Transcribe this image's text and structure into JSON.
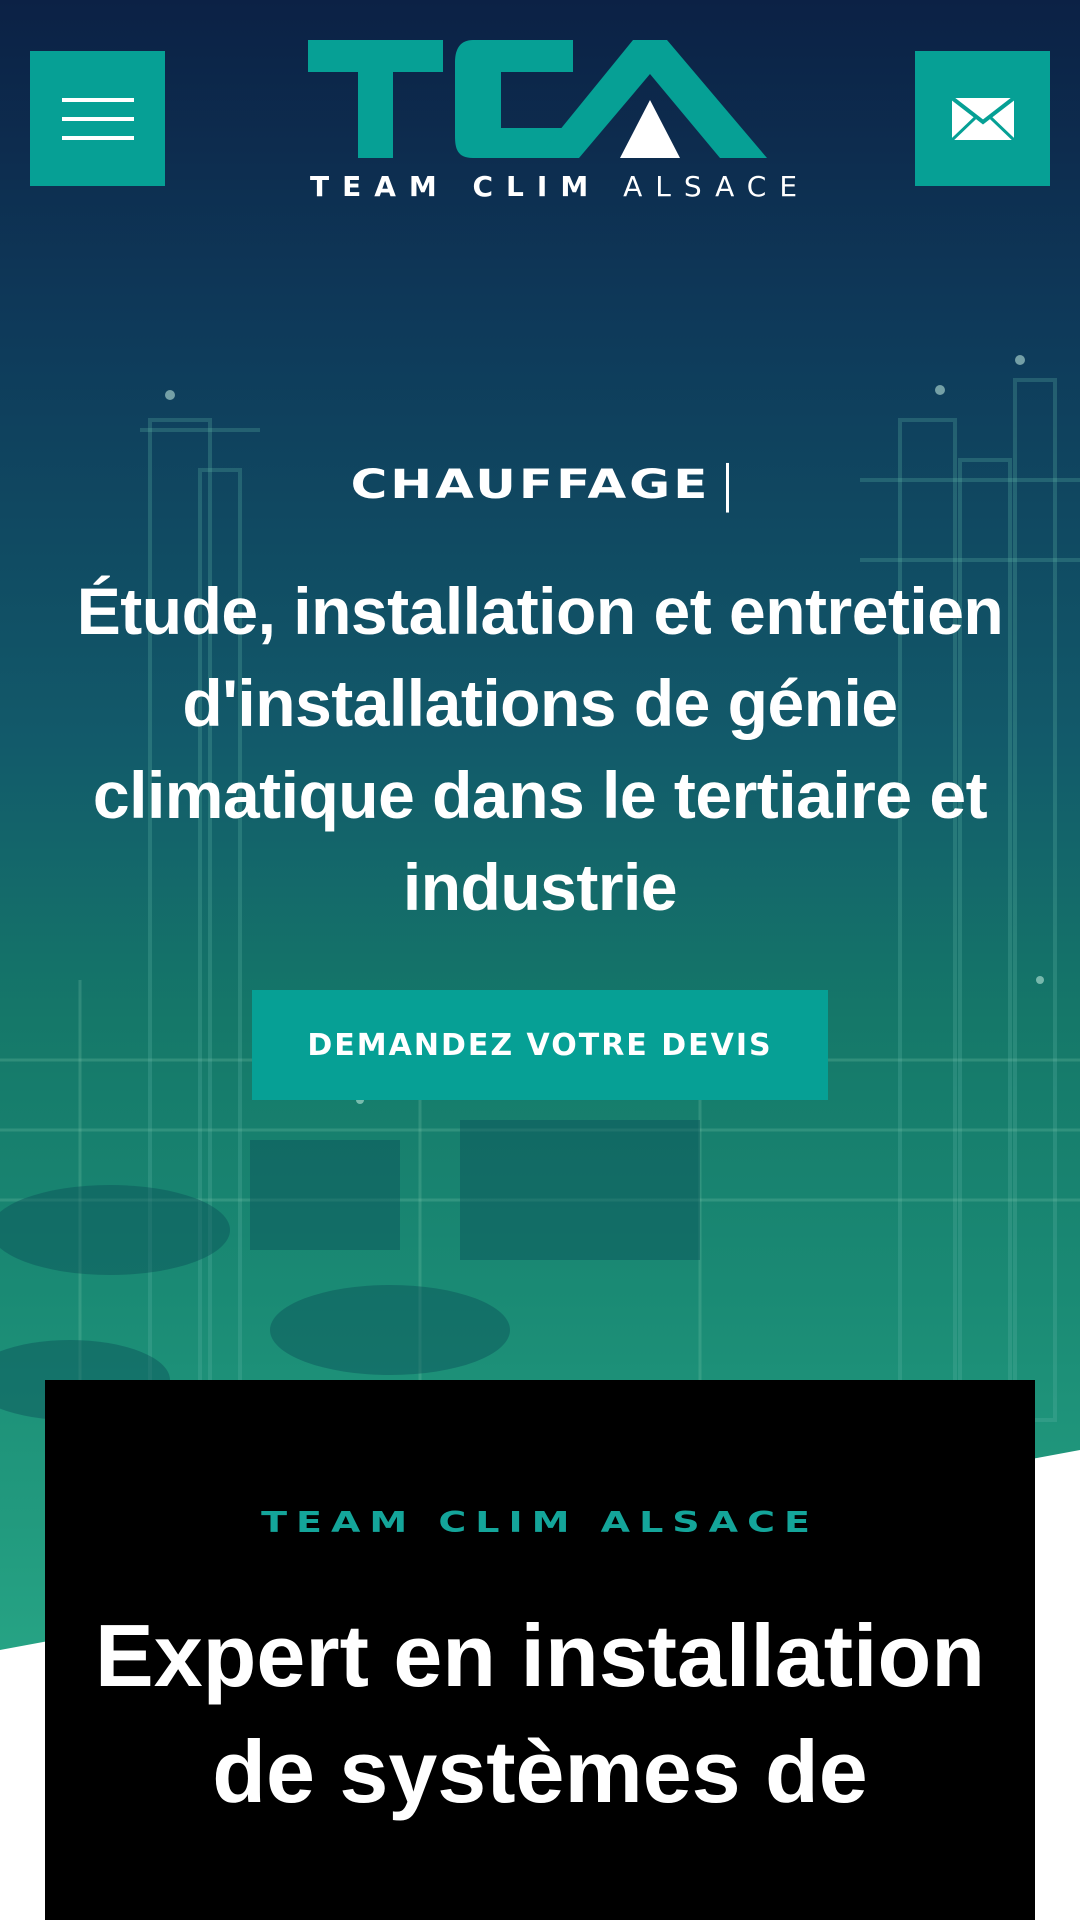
{
  "header": {
    "logo_letters": "TCA",
    "logo_sub_bold": "TEAM CLIM",
    "logo_sub_light": "ALSACE"
  },
  "hero": {
    "typed_word": "CHAUFFAGE",
    "headline": "Étude, installation et entretien d'installations de génie climatique dans le tertiaire et industrie",
    "cta_label": "DEMANDEZ VOTRE DEVIS"
  },
  "intro": {
    "tag": "TEAM CLIM ALSACE",
    "title": "Expert en installation de systèmes de"
  },
  "colors": {
    "accent": "#06a095",
    "tag_color": "#14a59a",
    "hero_top": "#0c2145",
    "hero_bottom": "#26a384",
    "card_bg": "#000000"
  },
  "icons": {
    "menu": "hamburger-icon",
    "mail": "envelope-icon"
  }
}
